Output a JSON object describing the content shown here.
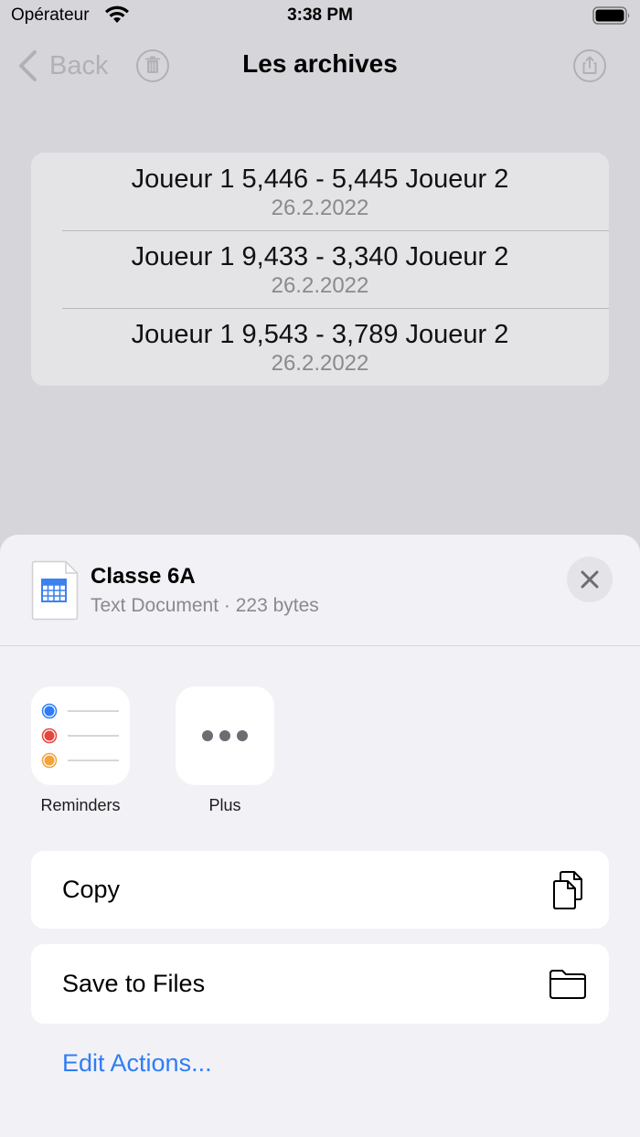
{
  "status_bar": {
    "carrier": "Opérateur",
    "time": "3:38 PM"
  },
  "nav": {
    "back_label": "Back",
    "title": "Les archives",
    "icons": [
      "chevron-left-icon",
      "trash-icon",
      "share-icon"
    ]
  },
  "archives": [
    {
      "score": "Joueur 1 5,446 - 5,445 Joueur 2",
      "date": "26.2.2022"
    },
    {
      "score": "Joueur 1 9,433 - 3,340 Joueur 2",
      "date": "26.2.2022"
    },
    {
      "score": "Joueur 1 9,543 - 3,789 Joueur 2",
      "date": "26.2.2022"
    }
  ],
  "share_sheet": {
    "doc_title": "Classe 6A",
    "doc_subtitle": "Text Document · 223 bytes",
    "apps": [
      {
        "label": "Reminders",
        "icon": "reminders-app-icon"
      },
      {
        "label": "Plus",
        "icon": "more-icon"
      }
    ],
    "actions": [
      {
        "label": "Copy",
        "icon": "copy-icon"
      },
      {
        "label": "Save to Files",
        "icon": "folder-icon"
      }
    ],
    "edit_actions_label": "Edit Actions..."
  },
  "colors": {
    "accent": "#2f7df6",
    "dimmed_background": "#d6d6da",
    "sheet_background": "#f2f2f6",
    "reminder_blue": "#2f7df6",
    "reminder_red": "#e5453d",
    "reminder_orange": "#f2a33a"
  }
}
